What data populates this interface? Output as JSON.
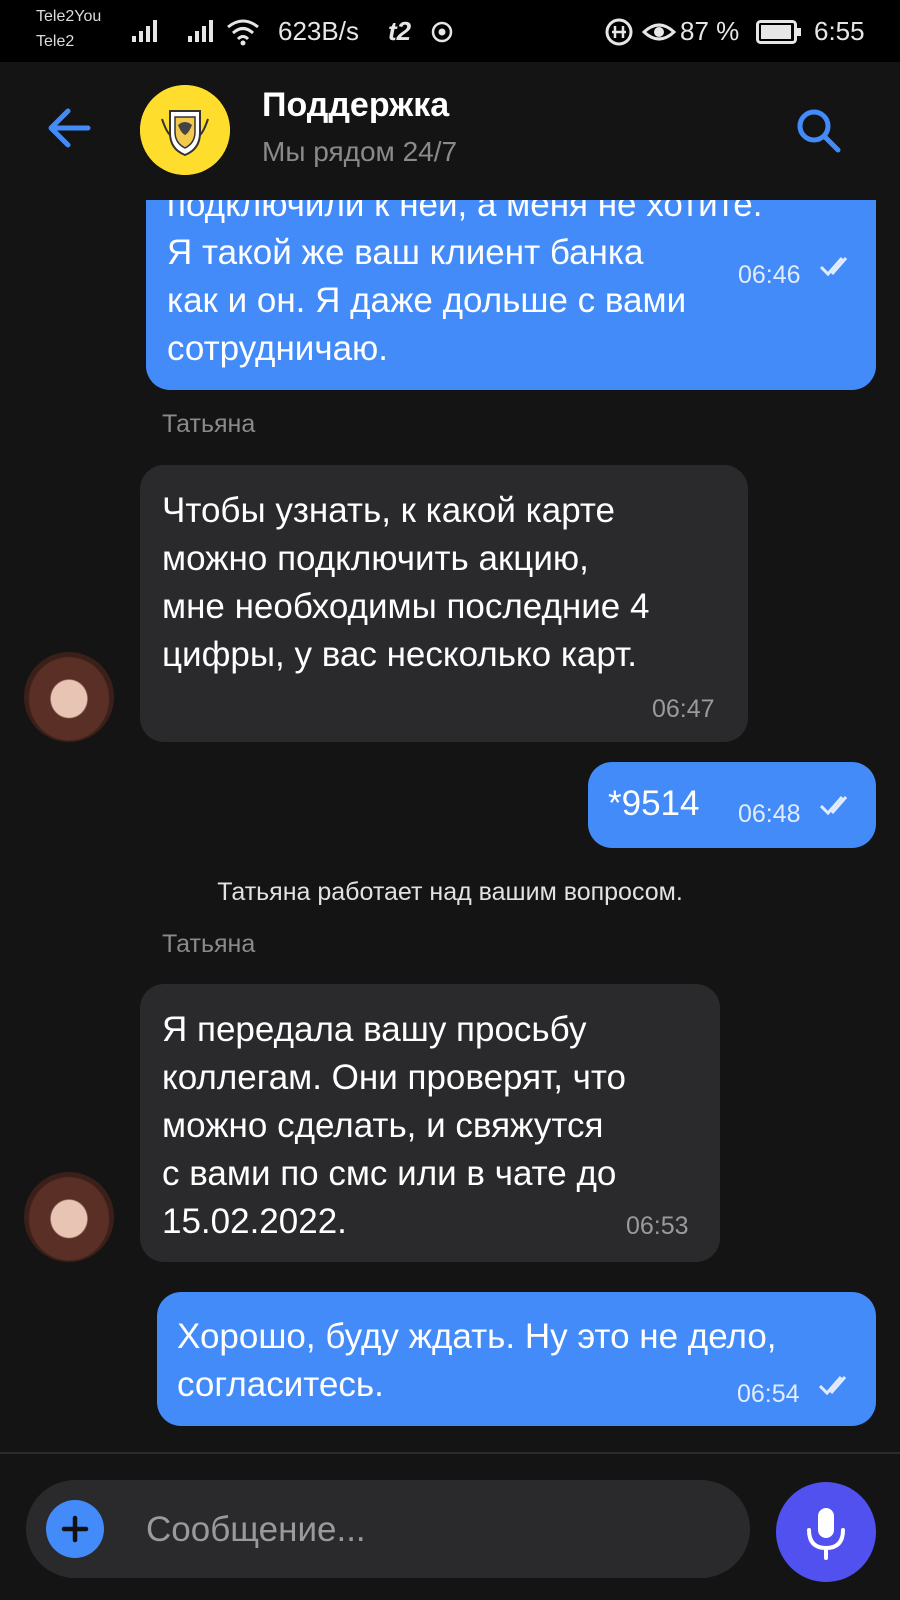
{
  "status_bar": {
    "carrier1": "Tele2You",
    "carrier2": "Tele2",
    "net_speed": "623B/s",
    "operator_logo": "t2",
    "battery_percent": "87 %",
    "time": "6:55"
  },
  "header": {
    "title": "Поддержка",
    "subtitle": "Мы рядом 24/7",
    "back_icon": "arrow-left-icon",
    "search_icon": "search-icon"
  },
  "messages": [
    {
      "direction": "out",
      "text": "подключили к ней, а меня не хотите.\nЯ такой же ваш клиент банка\nкак и он. Я даже дольше с вами\nсотрудничаю.",
      "time": "06:46",
      "read": true
    },
    {
      "direction": "in",
      "sender": "Татьяна",
      "text": "Чтобы узнать, к какой карте\nможно подключить акцию,\nмне необходимы последние 4\nцифры, у вас несколько карт.",
      "time": "06:47"
    },
    {
      "direction": "out",
      "text": "*9514",
      "time": "06:48",
      "read": true
    },
    {
      "direction": "system",
      "text": "Татьяна работает над вашим вопросом."
    },
    {
      "direction": "in",
      "sender": "Татьяна",
      "text": "Я передала вашу просьбу\nколлегам. Они проверят, что\nможно сделать, и свяжутся\nс вами по смс или в чате до\n15.02.2022.",
      "time": "06:53"
    },
    {
      "direction": "out",
      "text": "Хорошо, буду ждать. Ну это не дело,\nсогласитесь.",
      "time": "06:54",
      "read": true
    }
  ],
  "input": {
    "placeholder": "Сообщение...",
    "attach_icon": "plus-icon",
    "mic_icon": "microphone-icon"
  },
  "colors": {
    "accent": "#428bf9",
    "incoming_bubble": "#2a2a2c",
    "background": "#141414",
    "mic_button": "#5151f0",
    "brand_yellow": "#ffdd2d"
  }
}
